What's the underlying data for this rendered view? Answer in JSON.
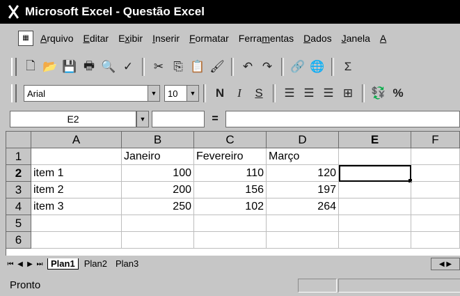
{
  "title": "Microsoft Excel - Questão Excel",
  "menu": [
    {
      "ul": "A",
      "rest": "rquivo"
    },
    {
      "ul": "E",
      "rest": "ditar"
    },
    {
      "pre": "E",
      "ul": "x",
      "rest": "ibir"
    },
    {
      "ul": "I",
      "rest": "nserir"
    },
    {
      "ul": "F",
      "rest": "ormatar"
    },
    {
      "pre": "Ferra",
      "ul": "m",
      "rest": "entas"
    },
    {
      "ul": "D",
      "rest": "ados"
    },
    {
      "ul": "J",
      "rest": "anela"
    },
    {
      "ul": "A",
      "rest": ""
    }
  ],
  "toolbar_std": {
    "icons": [
      "new-icon",
      "open-icon",
      "save-icon",
      "print-icon",
      "print-preview-icon",
      "spelling-icon",
      "cut-icon",
      "copy-icon",
      "paste-icon",
      "format-painter-icon",
      "undo-icon",
      "redo-icon",
      "hyperlink-icon",
      "web-icon",
      "autosum-icon"
    ],
    "glyphs": {
      "new-icon": "🗋",
      "open-icon": "📂",
      "save-icon": "💾",
      "print-icon": "🖶",
      "print-preview-icon": "🔍",
      "spelling-icon": "✓",
      "cut-icon": "✂",
      "copy-icon": "⎘",
      "paste-icon": "📋",
      "format-painter-icon": "🖌",
      "undo-icon": "↶",
      "redo-icon": "↷",
      "hyperlink-icon": "🔗",
      "web-icon": "🌐",
      "autosum-icon": "Σ"
    }
  },
  "toolbar_fmt": {
    "font": "Arial",
    "size": "10",
    "bold": "N",
    "italic": "I",
    "underline": "S",
    "percent": "%"
  },
  "formula": {
    "name_box": "E2",
    "equals": "=",
    "content": ""
  },
  "sheet": {
    "columns": [
      "A",
      "B",
      "C",
      "D",
      "E",
      "F"
    ],
    "rows": [
      "1",
      "2",
      "3",
      "4",
      "5",
      "6"
    ],
    "cells": [
      [
        "",
        "Janeiro",
        "Fevereiro",
        "Março",
        "",
        ""
      ],
      [
        "item 1",
        "100",
        "110",
        "120",
        "",
        ""
      ],
      [
        "item 2",
        "200",
        "156",
        "197",
        "",
        ""
      ],
      [
        "item 3",
        "250",
        "102",
        "264",
        "",
        ""
      ],
      [
        "",
        "",
        "",
        "",
        "",
        ""
      ],
      [
        "",
        "",
        "",
        "",
        "",
        ""
      ]
    ],
    "active_cell": "E2"
  },
  "tabs": [
    "Plan1",
    "Plan2",
    "Plan3"
  ],
  "active_tab": "Plan1",
  "status": "Pronto"
}
